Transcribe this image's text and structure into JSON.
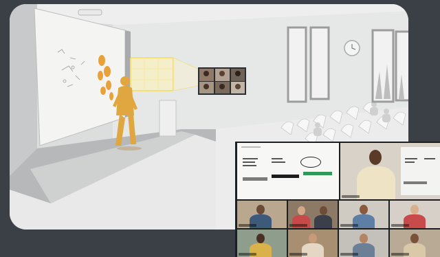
{
  "scene": {
    "description_alt": "",
    "room_theme": "white-lecture-hall"
  },
  "colors": {
    "frame_bg": "#3b4046",
    "room": "#d9dadb",
    "presenter": "#e0a640",
    "highlight": "#f3df7a",
    "slide_green": "#2f9a55",
    "slide_gray": "#7b7b7b",
    "slide_black": "#1c1c1c"
  },
  "call_grid": {
    "shared_slides": [
      {
        "title": "",
        "labels": [
          "",
          "",
          ""
        ]
      },
      {
        "title": "",
        "labels": [
          "",
          ""
        ]
      }
    ],
    "participants": 10
  }
}
